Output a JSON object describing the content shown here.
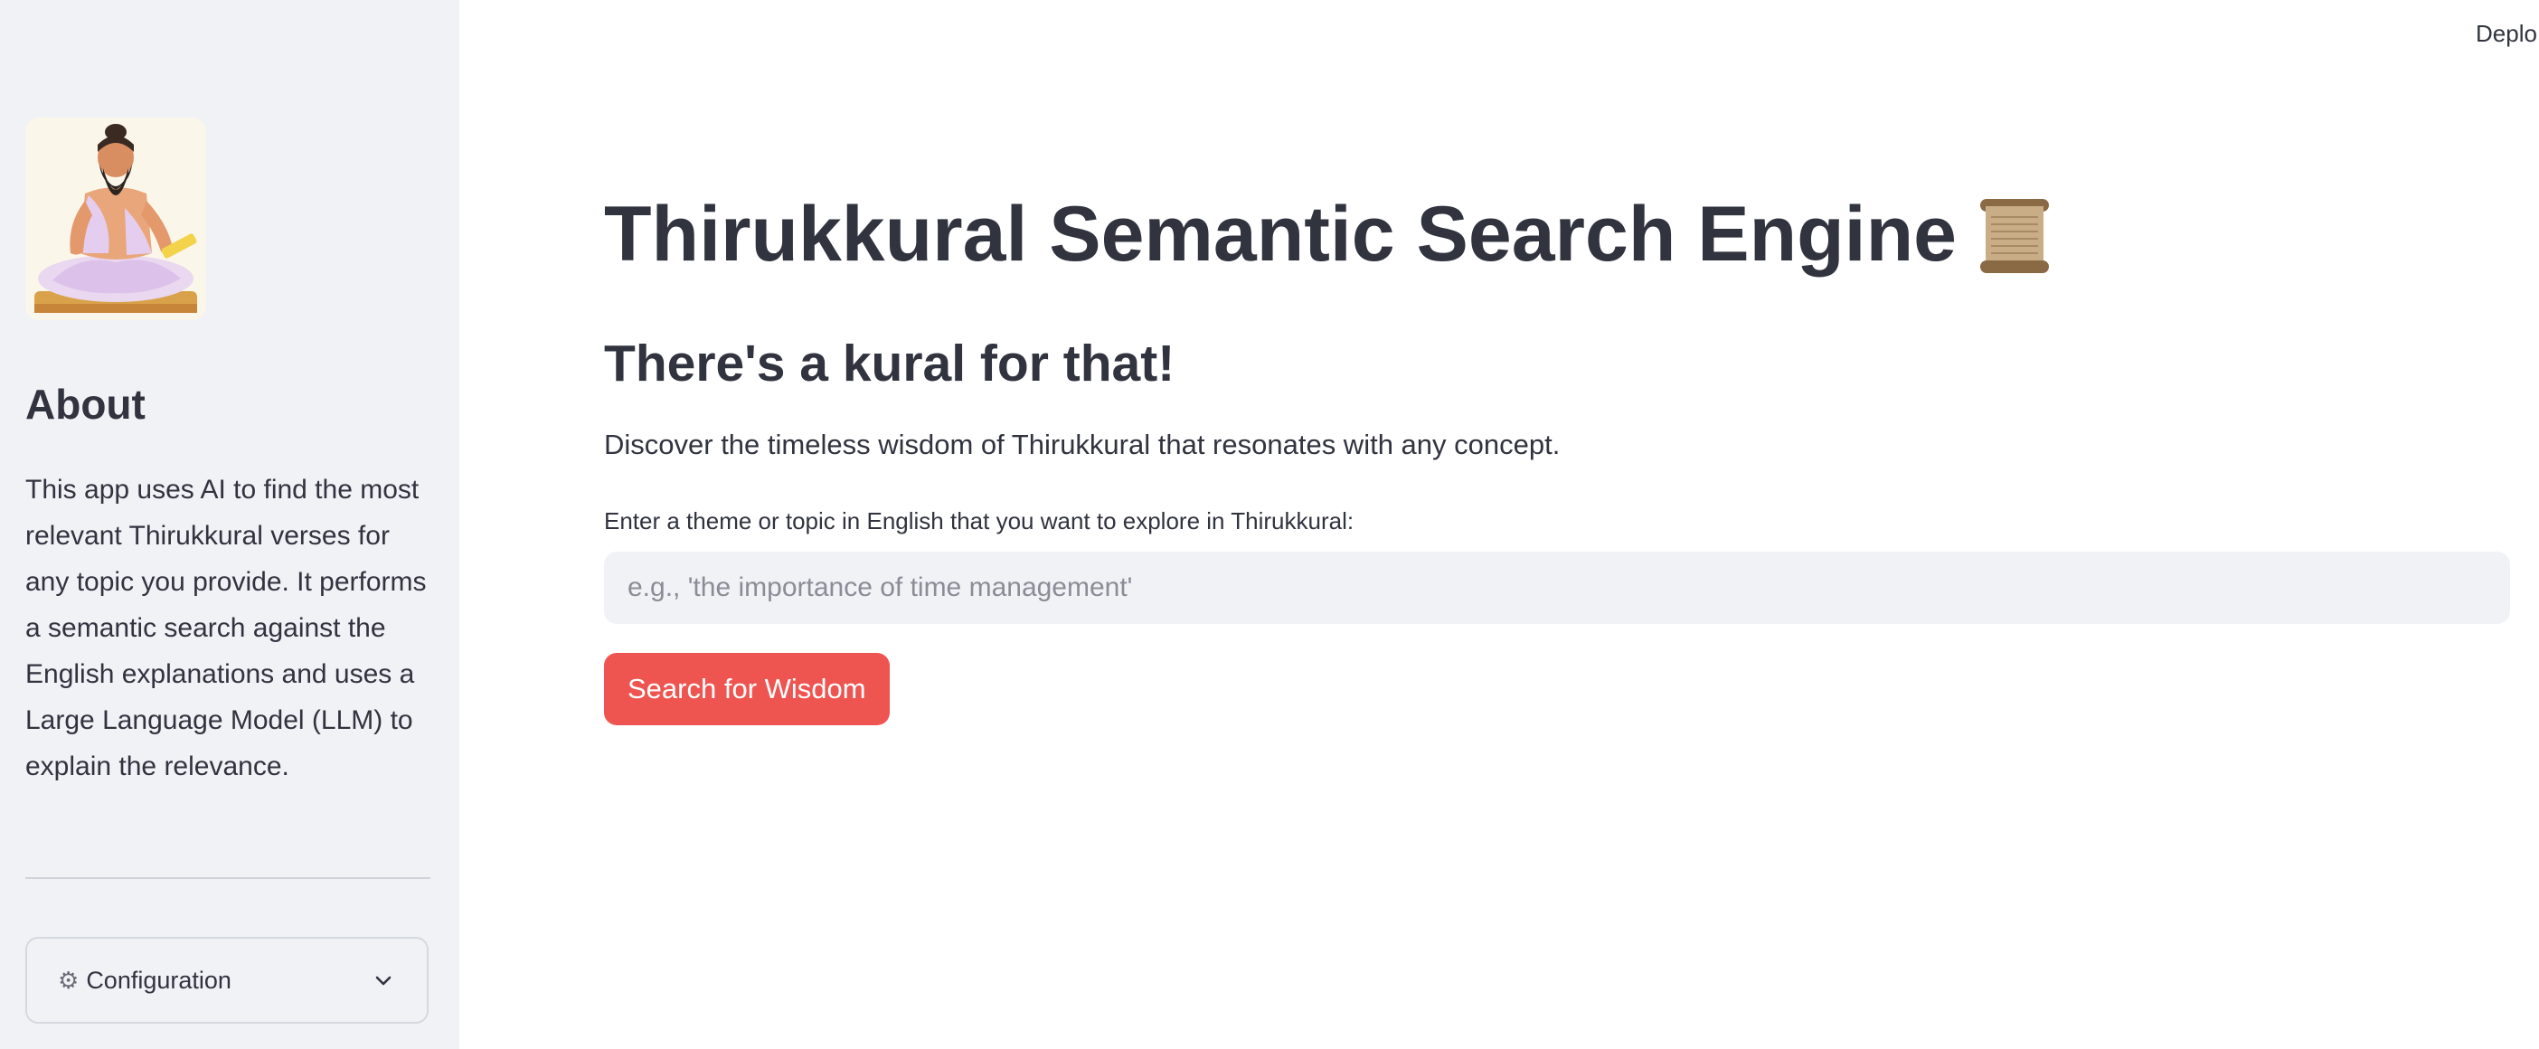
{
  "header": {
    "deploy_label": "Deplo"
  },
  "sidebar": {
    "avatar_icon": "thiruvalluvar-portrait",
    "about_title": "About",
    "about_text": "This app uses AI to find the most relevant Thirukkural verses for any topic you provide. It performs a semantic search against the English explanations and uses a Large Language Model (LLM) to explain the relevance.",
    "config": {
      "icon": "gear-icon",
      "label": "Configuration",
      "chevron": "chevron-down-icon"
    }
  },
  "main": {
    "title": "Thirukkural Semantic Search Engine",
    "title_icon": "scroll-icon",
    "subtitle": "There's a kural for that!",
    "description": "Discover the timeless wisdom of Thirukkural that resonates with any concept.",
    "input_label": "Enter a theme or topic in English that you want to explore in Thirukkural:",
    "input_value": "",
    "input_placeholder": "e.g., 'the importance of time management'",
    "button_label": "Search for Wisdom"
  },
  "colors": {
    "sidebar_bg": "#f0f2f6",
    "text": "#31333f",
    "primary_button": "#ef5550",
    "input_bg": "#f0f2f6"
  }
}
